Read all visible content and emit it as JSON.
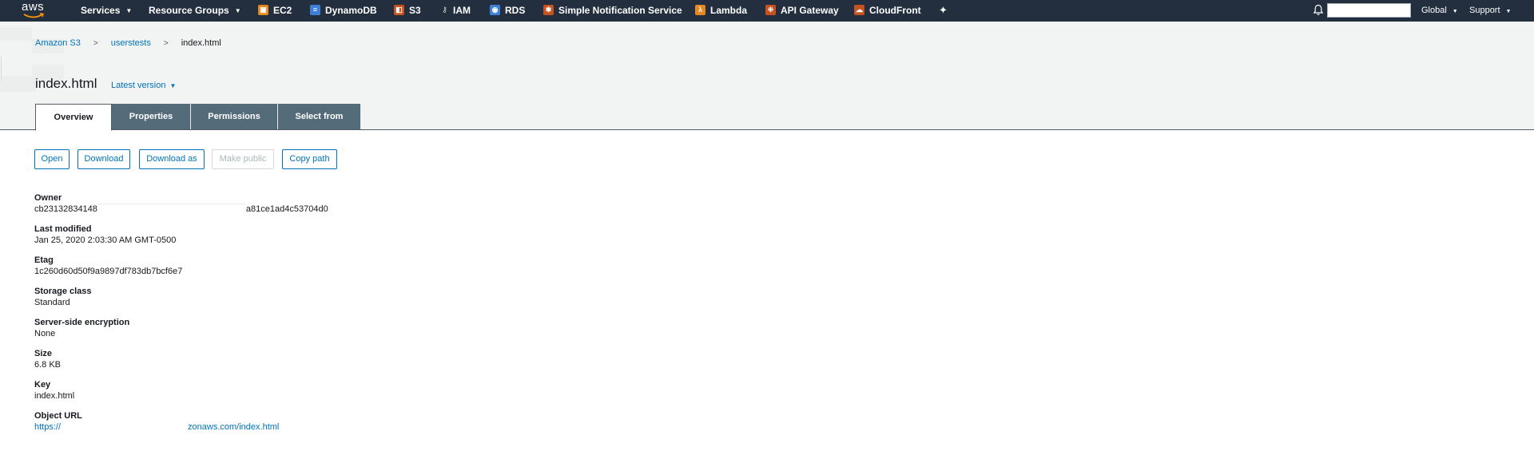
{
  "topnav": {
    "logo": "aws",
    "menus": [
      {
        "label": "Services",
        "icon": "chevron-down-icon"
      },
      {
        "label": "Resource Groups",
        "icon": "chevron-down-icon"
      }
    ],
    "pinned_services": [
      {
        "label": "EC2",
        "icon": "ec2-icon",
        "color": "#e8871e"
      },
      {
        "label": "DynamoDB",
        "icon": "dynamodb-icon",
        "color": "#3f7fd6"
      },
      {
        "label": "S3",
        "icon": "s3-icon",
        "color": "#c7511f"
      },
      {
        "label": "IAM",
        "icon": "iam-icon",
        "color": "#aaaaaa"
      },
      {
        "label": "RDS",
        "icon": "rds-icon",
        "color": "#3f7fd6"
      },
      {
        "label": "Simple Notification Service",
        "icon": "sns-icon",
        "color": "#c7511f"
      },
      {
        "label": "Lambda",
        "icon": "lambda-icon",
        "color": "#e8871e"
      },
      {
        "label": "API Gateway",
        "icon": "api-gateway-icon",
        "color": "#c7511f"
      },
      {
        "label": "CloudFront",
        "icon": "cloudfront-icon",
        "color": "#c7511f"
      }
    ],
    "pin_icon": "pin-icon",
    "bell_icon": "bell-icon",
    "search_value": "",
    "region": "Global",
    "support": "Support"
  },
  "breadcrumb": {
    "items": [
      "Amazon S3",
      "userstests"
    ],
    "current": "index.html"
  },
  "object": {
    "title": "index.html",
    "version_label": "Latest version"
  },
  "tabs": [
    "Overview",
    "Properties",
    "Permissions",
    "Select from"
  ],
  "actions": [
    "Open",
    "Download",
    "Download as",
    "Make public",
    "Copy path"
  ],
  "properties": [
    {
      "label": "Owner",
      "value_start": "cb23132834148",
      "value_end": "a81ce1ad4c53704d0"
    },
    {
      "label": "Last modified",
      "value": "Jan 25, 2020 2:03:30 AM GMT-0500"
    },
    {
      "label": "Etag",
      "value": "1c260d60d50f9a9897df783db7bcf6e7"
    },
    {
      "label": "Storage class",
      "value": "Standard"
    },
    {
      "label": "Server-side encryption",
      "value": "None"
    },
    {
      "label": "Size",
      "value": "6.8 KB"
    },
    {
      "label": "Key",
      "value": "index.html"
    },
    {
      "label": "Object URL",
      "value_start": "https://",
      "value_end": "zonaws.com/index.html"
    }
  ],
  "colors": {
    "nav_bg": "#232f3e",
    "header_bg": "#f2f3f3",
    "tab_inactive": "#546b7a",
    "link": "#0073bb"
  }
}
